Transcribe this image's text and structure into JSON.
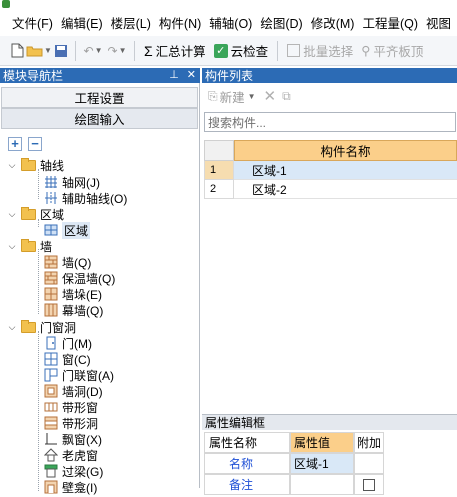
{
  "menu": [
    "文件(F)",
    "编辑(E)",
    "楼层(L)",
    "构件(N)",
    "辅轴(O)",
    "绘图(D)",
    "修改(M)",
    "工程量(Q)",
    "视图"
  ],
  "toolbar": {
    "sum_label": "汇总计算",
    "cloud_check_label": "云检查",
    "batch_select_label": "批量选择",
    "align_top_label": "平齐板顶"
  },
  "left_panel": {
    "title": "模块导航栏",
    "project_settings": "工程设置",
    "drawing_input": "绘图输入",
    "tree": {
      "axis": {
        "label": "轴线",
        "children": [
          "轴网(J)",
          "辅助轴线(O)"
        ]
      },
      "region": {
        "label": "区域",
        "children": [
          "区域"
        ]
      },
      "wall": {
        "label": "墙",
        "children": [
          "墙(Q)",
          "保温墙(Q)",
          "墙垛(E)",
          "幕墙(Q)"
        ]
      },
      "openings": {
        "label": "门窗洞",
        "children": [
          "门(M)",
          "窗(C)",
          "门联窗(A)",
          "墙洞(D)",
          "带形窗",
          "带形洞",
          "飘窗(X)",
          "老虎窗",
          "过梁(G)",
          "壁龛(I)"
        ]
      }
    }
  },
  "component_list": {
    "title": "构件列表",
    "new_label": "新建",
    "search_placeholder": "搜索构件...",
    "column_header": "构件名称",
    "rows": [
      {
        "index": "1",
        "name": "区域-1"
      },
      {
        "index": "2",
        "name": "区域-2"
      }
    ]
  },
  "property_editor": {
    "title": "属性编辑框",
    "headers": [
      "属性名称",
      "属性值",
      "附加"
    ],
    "rows": [
      {
        "name": "名称",
        "value": "区域-1"
      },
      {
        "name": "备注",
        "value": ""
      }
    ]
  },
  "colors": {
    "panel_title_blue": "#2c6bb5",
    "header_orange": "#fbcf8a",
    "selection_blue": "#d9e8f7"
  }
}
